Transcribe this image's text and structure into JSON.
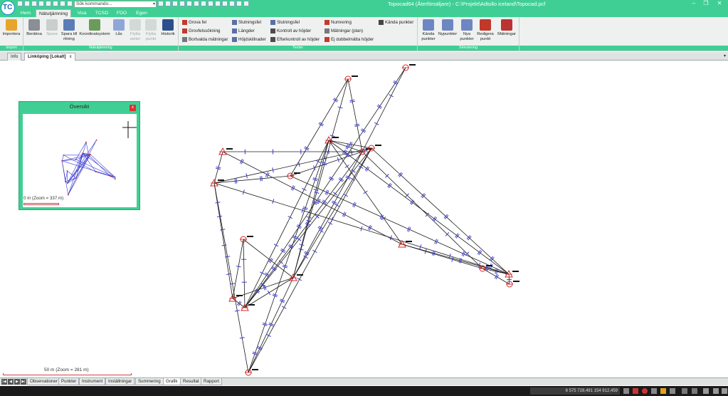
{
  "titlebar": {
    "logo": "TC",
    "command_placeholder": "Sök kommando...",
    "window_title": "Topocad64 (Återförsäljare) - C:\\Projekt\\Adtollo iceland\\Topocad.pcf"
  },
  "ribbon_tabs": [
    "Hem",
    "Nätutjämning",
    "Visa",
    "TCSD",
    "FDO",
    "Egen"
  ],
  "ribbon": {
    "import_group": {
      "label": "Import",
      "importera": "Importera"
    },
    "natutjamning_group": {
      "label": "Nätutjämning",
      "berakna": "Beräkna",
      "spara": "Spara",
      "spara_till_ritning": "Spara till ritning",
      "koordinatsystem": "Koordinatsystem",
      "las": "Lås",
      "flytta_serier": "Flytta serier",
      "flytta_punkt": "Flytta punkt",
      "historik": "Historik"
    },
    "texter_group": {
      "label": "Texter",
      "col1": [
        "Grova fel",
        "Grovfelssökning",
        "Bortvalda mätningar"
      ],
      "col2": [
        "Slutningsfel",
        "Längder",
        "Höjdskillnader"
      ],
      "col3": [
        "Slutningsfel",
        "Kontroll av höjder",
        "Efterkontroll av höjder"
      ],
      "col4": [
        "Numrering",
        "Mätningar (plan)",
        "Ej dubbelmätta höjder"
      ],
      "col5": [
        "Kända punkter"
      ]
    },
    "simulering_group": {
      "label": "Simulering",
      "kanda_punkter": "Kända punkter",
      "nypunkter": "Nypunkter",
      "nya_punkter": "Nya punkter",
      "redigera_punkt": "Redigera punkt",
      "matningar": "Mätningar"
    }
  },
  "doc_tabs": {
    "info": "Info",
    "active": "Linköping [Lokalt]",
    "close": "x"
  },
  "overview": {
    "title": "Översikt",
    "close": "x",
    "scale_label": "0 m (Zoom = 337 m)"
  },
  "canvas": {
    "scale_label": "50 m (Zoom = 281 m)"
  },
  "sheet_tabs": [
    "Observationer",
    "Punkter",
    "Instrument",
    "Inställningar",
    "Summering",
    "Grafik",
    "Resultat",
    "Rapport"
  ],
  "sheet_tabs_active": "Grafik",
  "statusbar": {
    "coordinates": "6 575 728,491 154 912,459"
  },
  "colors": {
    "accent": "#3fcf95",
    "network_line": "#1a1a1a",
    "observation_tick": "#3b3bd1",
    "point_marker": "#d62828"
  }
}
